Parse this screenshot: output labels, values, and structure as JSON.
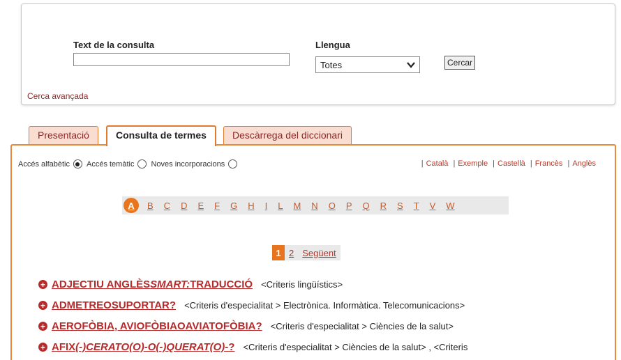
{
  "search": {
    "query_label": "Text de la consulta",
    "query_value": "",
    "language_label": "Llengua",
    "language_selected": "Totes",
    "search_button": "Cercar",
    "advanced_link": "Cerca avançada"
  },
  "tabs": [
    {
      "label": "Presentació",
      "active": false
    },
    {
      "label": "Consulta de termes",
      "active": true
    },
    {
      "label": "Descàrrega del diccionari",
      "active": false
    }
  ],
  "modes": [
    {
      "label": "Accés alfabètic",
      "checked": true
    },
    {
      "label": "Accés temàtic",
      "checked": false
    },
    {
      "label": "Noves incorporacions",
      "checked": false
    }
  ],
  "languages": [
    "Català",
    "Exemple",
    "Castellà",
    "Francès",
    "Anglès"
  ],
  "alphabet": {
    "active": "A",
    "letters": [
      "A",
      "B",
      "C",
      "D",
      "E",
      "F",
      "G",
      "H",
      "I",
      "L",
      "M",
      "N",
      "O",
      "P",
      "Q",
      "R",
      "S",
      "T",
      "V",
      "W"
    ]
  },
  "pager": {
    "current": "1",
    "next_page": "2",
    "next_label": "Següent"
  },
  "results": [
    {
      "term_parts": [
        {
          "t": "ADJECTIU ANGLÈS",
          "i": false
        },
        {
          "t": "SMART:",
          "i": true
        },
        {
          "t": "TRADUCCIÓ",
          "i": false
        }
      ],
      "category": "<Criteris lingüístics>"
    },
    {
      "term_parts": [
        {
          "t": "ADMETREOSUPORTAR?",
          "i": false
        }
      ],
      "category": "<Criteris d'especialitat > Electrònica. Informàtica. Telecomunicacions>"
    },
    {
      "term_parts": [
        {
          "t": "AEROFÒBIA, AVIOFÒBIAOAVIATOFÒBIA?",
          "i": false
        }
      ],
      "category": "<Criteris d'especialitat > Ciències de la salut>"
    },
    {
      "term_parts": [
        {
          "t": "AFIX",
          "i": false
        },
        {
          "t": "(-)CERATO(O)-O(-)QUERAT(O)",
          "i": true
        },
        {
          "t": "-?",
          "i": false
        }
      ],
      "category": "<Criteris d'especialitat > Ciències de la salut> , <Criteris"
    }
  ],
  "colors": {
    "accent": "#e8741e",
    "brand_red": "#b82a2a",
    "tab_inactive_bg": "#f8ddd0"
  }
}
